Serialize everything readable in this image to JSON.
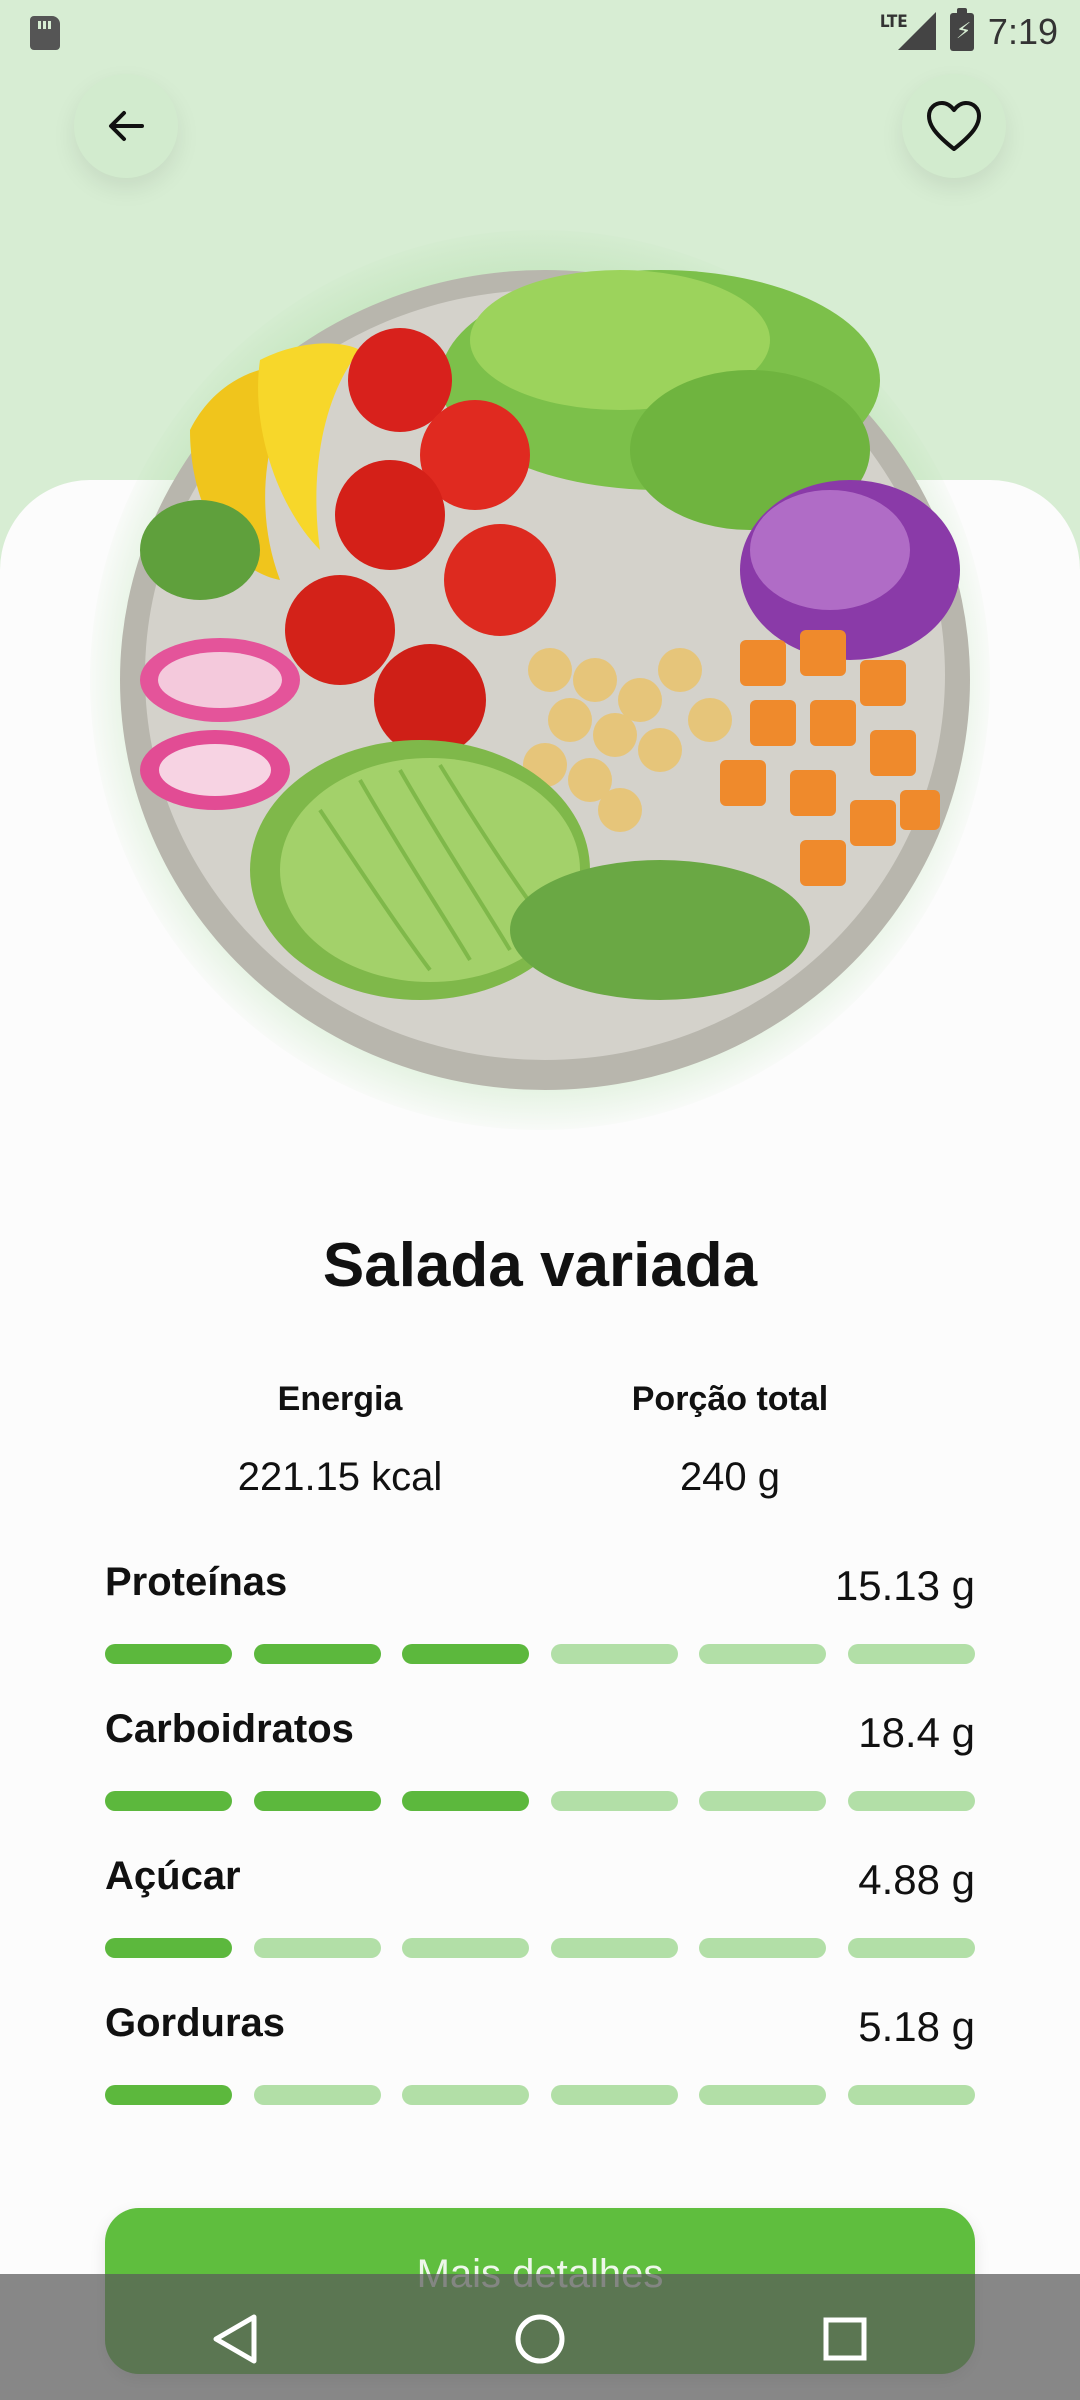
{
  "status_bar": {
    "time": "7:19",
    "network": "LTE",
    "icons": [
      "sd-card-icon",
      "signal-icon",
      "battery-charging-icon"
    ]
  },
  "header": {
    "back_icon": "arrow-left-icon",
    "favorite_icon": "heart-outline-icon"
  },
  "dish": {
    "title": "Salada variada",
    "image": "salad-bowl-photo"
  },
  "summary": {
    "energy_label": "Energia",
    "energy_value": "221.15 kcal",
    "portion_label": "Porção total",
    "portion_value": "240 g"
  },
  "nutrients": [
    {
      "name": "Proteínas",
      "amount": "15.13 g",
      "level": 3,
      "max_level": 6
    },
    {
      "name": "Carboidratos",
      "amount": "18.4 g",
      "level": 3,
      "max_level": 6
    },
    {
      "name": "Açúcar",
      "amount": "4.88 g",
      "level": 1,
      "max_level": 6
    },
    {
      "name": "Gorduras",
      "amount": "5.18 g",
      "level": 1,
      "max_level": 6
    }
  ],
  "actions": {
    "details_label": "Mais detalhes"
  },
  "nav": {
    "back_icon": "triangle-back-icon",
    "home_icon": "circle-home-icon",
    "recents_icon": "square-recents-icon"
  },
  "colors": {
    "accent": "#5fbe3e",
    "bar_on": "#5cb83d",
    "bar_off": "#b2dfa7",
    "background_top": "#d7edd3"
  }
}
